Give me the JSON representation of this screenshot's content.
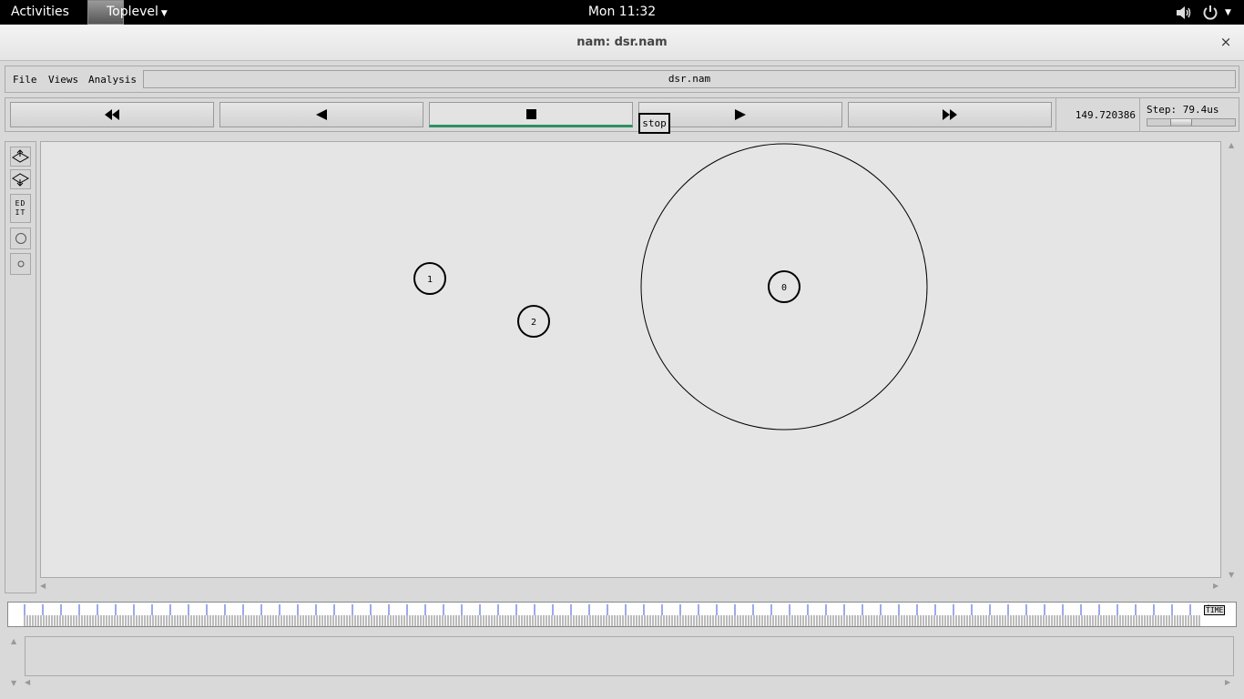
{
  "topbar": {
    "activities": "Activities",
    "app_menu": "Toplevel",
    "clock": "Mon 11:32",
    "icons": [
      "volume-icon",
      "power-icon"
    ]
  },
  "window": {
    "title": "nam: dsr.nam",
    "close_glyph": "×"
  },
  "menu": {
    "items": [
      "File",
      "Views",
      "Analysis"
    ],
    "filename": "dsr.nam"
  },
  "controls": {
    "buttons": [
      "fast-rewind",
      "rewind",
      "stop",
      "play",
      "fast-forward"
    ],
    "active": "stop",
    "tooltip": "stop",
    "time": "149.720386",
    "step_label": "Step: 79.4us",
    "step_slider_fraction": 0.35
  },
  "tools": {
    "edit_label": "ED IT"
  },
  "network": {
    "nodes": [
      {
        "label": "1"
      },
      {
        "label": "2"
      },
      {
        "label": "0"
      }
    ]
  },
  "timeline": {
    "label": "TIME"
  }
}
